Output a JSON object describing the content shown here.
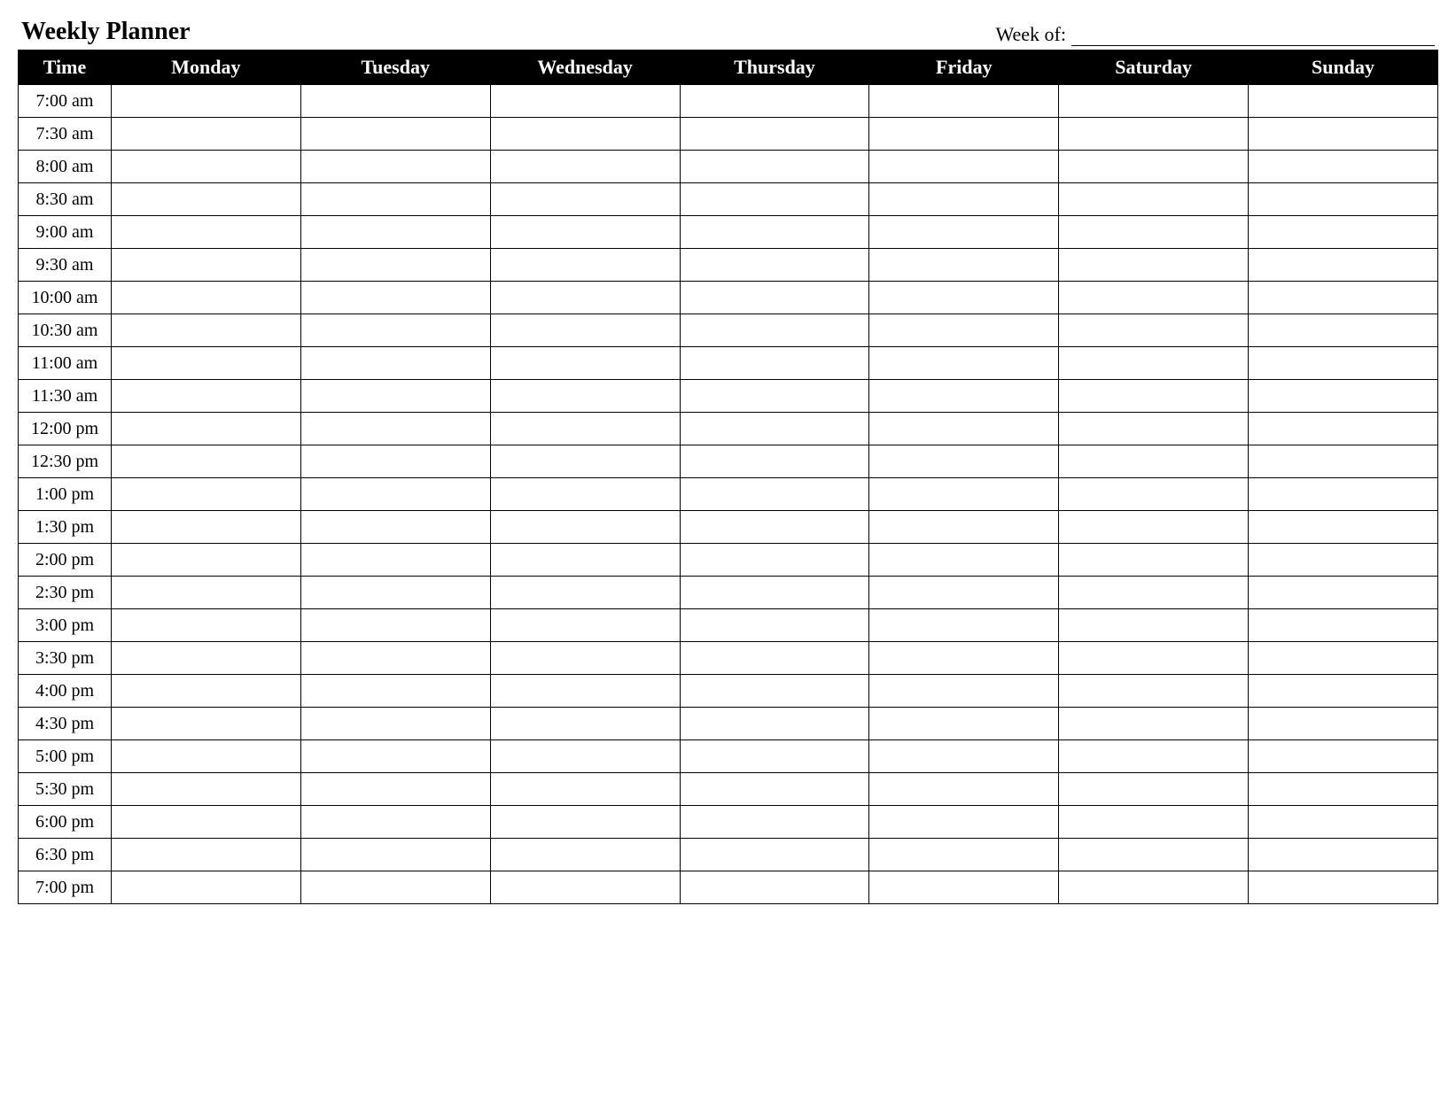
{
  "header": {
    "title": "Weekly Planner",
    "week_of_label": "Week of:",
    "week_of_value": ""
  },
  "table": {
    "columns": [
      "Time",
      "Monday",
      "Tuesday",
      "Wednesday",
      "Thursday",
      "Friday",
      "Saturday",
      "Sunday"
    ],
    "rows": [
      {
        "time": "7:00 am",
        "cells": [
          "",
          "",
          "",
          "",
          "",
          "",
          ""
        ]
      },
      {
        "time": "7:30 am",
        "cells": [
          "",
          "",
          "",
          "",
          "",
          "",
          ""
        ]
      },
      {
        "time": "8:00 am",
        "cells": [
          "",
          "",
          "",
          "",
          "",
          "",
          ""
        ]
      },
      {
        "time": "8:30 am",
        "cells": [
          "",
          "",
          "",
          "",
          "",
          "",
          ""
        ]
      },
      {
        "time": "9:00 am",
        "cells": [
          "",
          "",
          "",
          "",
          "",
          "",
          ""
        ]
      },
      {
        "time": "9:30 am",
        "cells": [
          "",
          "",
          "",
          "",
          "",
          "",
          ""
        ]
      },
      {
        "time": "10:00 am",
        "cells": [
          "",
          "",
          "",
          "",
          "",
          "",
          ""
        ]
      },
      {
        "time": "10:30 am",
        "cells": [
          "",
          "",
          "",
          "",
          "",
          "",
          ""
        ]
      },
      {
        "time": "11:00 am",
        "cells": [
          "",
          "",
          "",
          "",
          "",
          "",
          ""
        ]
      },
      {
        "time": "11:30 am",
        "cells": [
          "",
          "",
          "",
          "",
          "",
          "",
          ""
        ]
      },
      {
        "time": "12:00 pm",
        "cells": [
          "",
          "",
          "",
          "",
          "",
          "",
          ""
        ]
      },
      {
        "time": "12:30 pm",
        "cells": [
          "",
          "",
          "",
          "",
          "",
          "",
          ""
        ]
      },
      {
        "time": "1:00 pm",
        "cells": [
          "",
          "",
          "",
          "",
          "",
          "",
          ""
        ]
      },
      {
        "time": "1:30 pm",
        "cells": [
          "",
          "",
          "",
          "",
          "",
          "",
          ""
        ]
      },
      {
        "time": "2:00 pm",
        "cells": [
          "",
          "",
          "",
          "",
          "",
          "",
          ""
        ]
      },
      {
        "time": "2:30 pm",
        "cells": [
          "",
          "",
          "",
          "",
          "",
          "",
          ""
        ]
      },
      {
        "time": "3:00 pm",
        "cells": [
          "",
          "",
          "",
          "",
          "",
          "",
          ""
        ]
      },
      {
        "time": "3:30 pm",
        "cells": [
          "",
          "",
          "",
          "",
          "",
          "",
          ""
        ]
      },
      {
        "time": "4:00 pm",
        "cells": [
          "",
          "",
          "",
          "",
          "",
          "",
          ""
        ]
      },
      {
        "time": "4:30 pm",
        "cells": [
          "",
          "",
          "",
          "",
          "",
          "",
          ""
        ]
      },
      {
        "time": "5:00 pm",
        "cells": [
          "",
          "",
          "",
          "",
          "",
          "",
          ""
        ]
      },
      {
        "time": "5:30 pm",
        "cells": [
          "",
          "",
          "",
          "",
          "",
          "",
          ""
        ]
      },
      {
        "time": "6:00 pm",
        "cells": [
          "",
          "",
          "",
          "",
          "",
          "",
          ""
        ]
      },
      {
        "time": "6:30 pm",
        "cells": [
          "",
          "",
          "",
          "",
          "",
          "",
          ""
        ]
      },
      {
        "time": "7:00 pm",
        "cells": [
          "",
          "",
          "",
          "",
          "",
          "",
          ""
        ]
      }
    ]
  }
}
